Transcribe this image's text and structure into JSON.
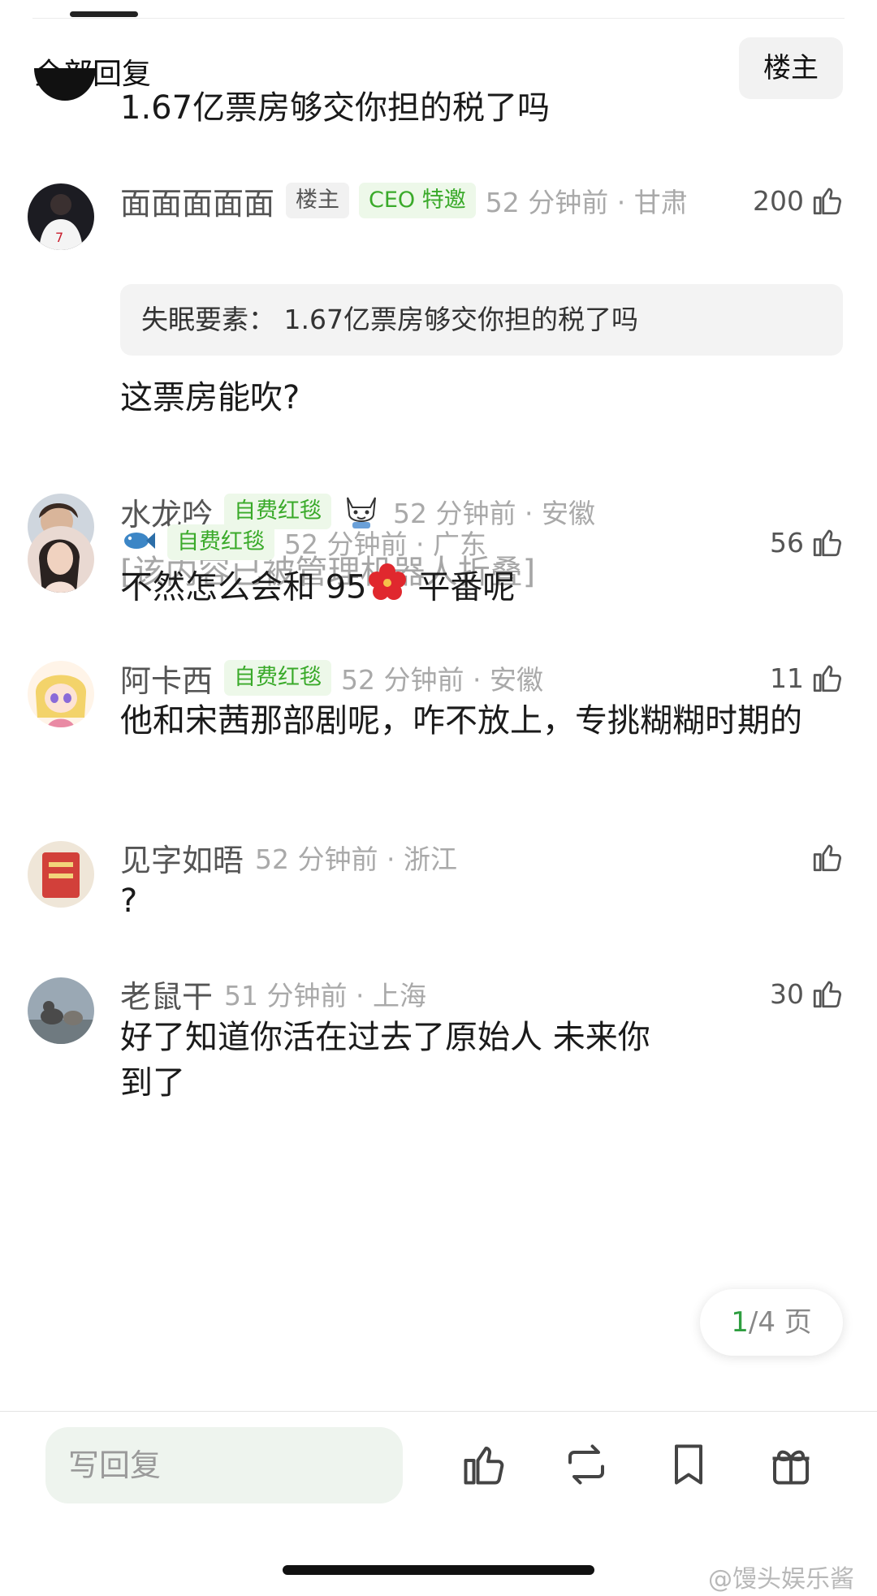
{
  "header": {
    "title": "全部回复",
    "op_filter": "楼主"
  },
  "comments": [
    {
      "text": "1.67亿票房够交你担的税了吗"
    },
    {
      "username": "面面面面面",
      "badge_op": "楼主",
      "badge": "CEO 特邀",
      "meta": "52 分钟前 · 甘肃",
      "likes": "200",
      "quote": "失眠要素： 1.67亿票房够交你担的税了吗",
      "text": "这票房能吹?"
    },
    {
      "username": "水龙吟",
      "badge": "自费红毯",
      "meta": "52 分钟前 · 安徽",
      "folded": "[该内容已被管理机器人折叠]"
    },
    {
      "username": "",
      "badge": "自费红毯",
      "meta": "52 分钟前 · 广东",
      "likes": "56",
      "text_a": "不然怎么会和 95",
      "text_b": " 平番呢"
    },
    {
      "username": "阿卡西",
      "badge": "自费红毯",
      "meta": "52 分钟前 · 安徽",
      "likes": "11",
      "text": "他和宋茜那部剧呢，咋不放上，专挑糊糊时期的"
    },
    {
      "username": "见字如晤",
      "meta": "52 分钟前 · 浙江",
      "likes": "",
      "text": "?"
    },
    {
      "username": "老鼠干",
      "meta": "51 分钟前 · 上海",
      "likes": "30",
      "text": "好了知道你活在过去了原始人 未来你"
    }
  ],
  "pager": {
    "current": "1",
    "total": "/4 页"
  },
  "bottom_bar": {
    "reply_placeholder": "写回复"
  },
  "watermark": "@馒头娱乐酱",
  "colors": {
    "accent_green": "#3aaa2a",
    "badge_bg": "#edf8e9",
    "meta_gray": "#a9a9a9"
  },
  "icons": [
    "thumbs-up-icon",
    "repost-icon",
    "bookmark-icon",
    "gift-icon",
    "fish-emoji-icon",
    "hibiscus-emoji-icon",
    "cat-sticker-icon"
  ]
}
